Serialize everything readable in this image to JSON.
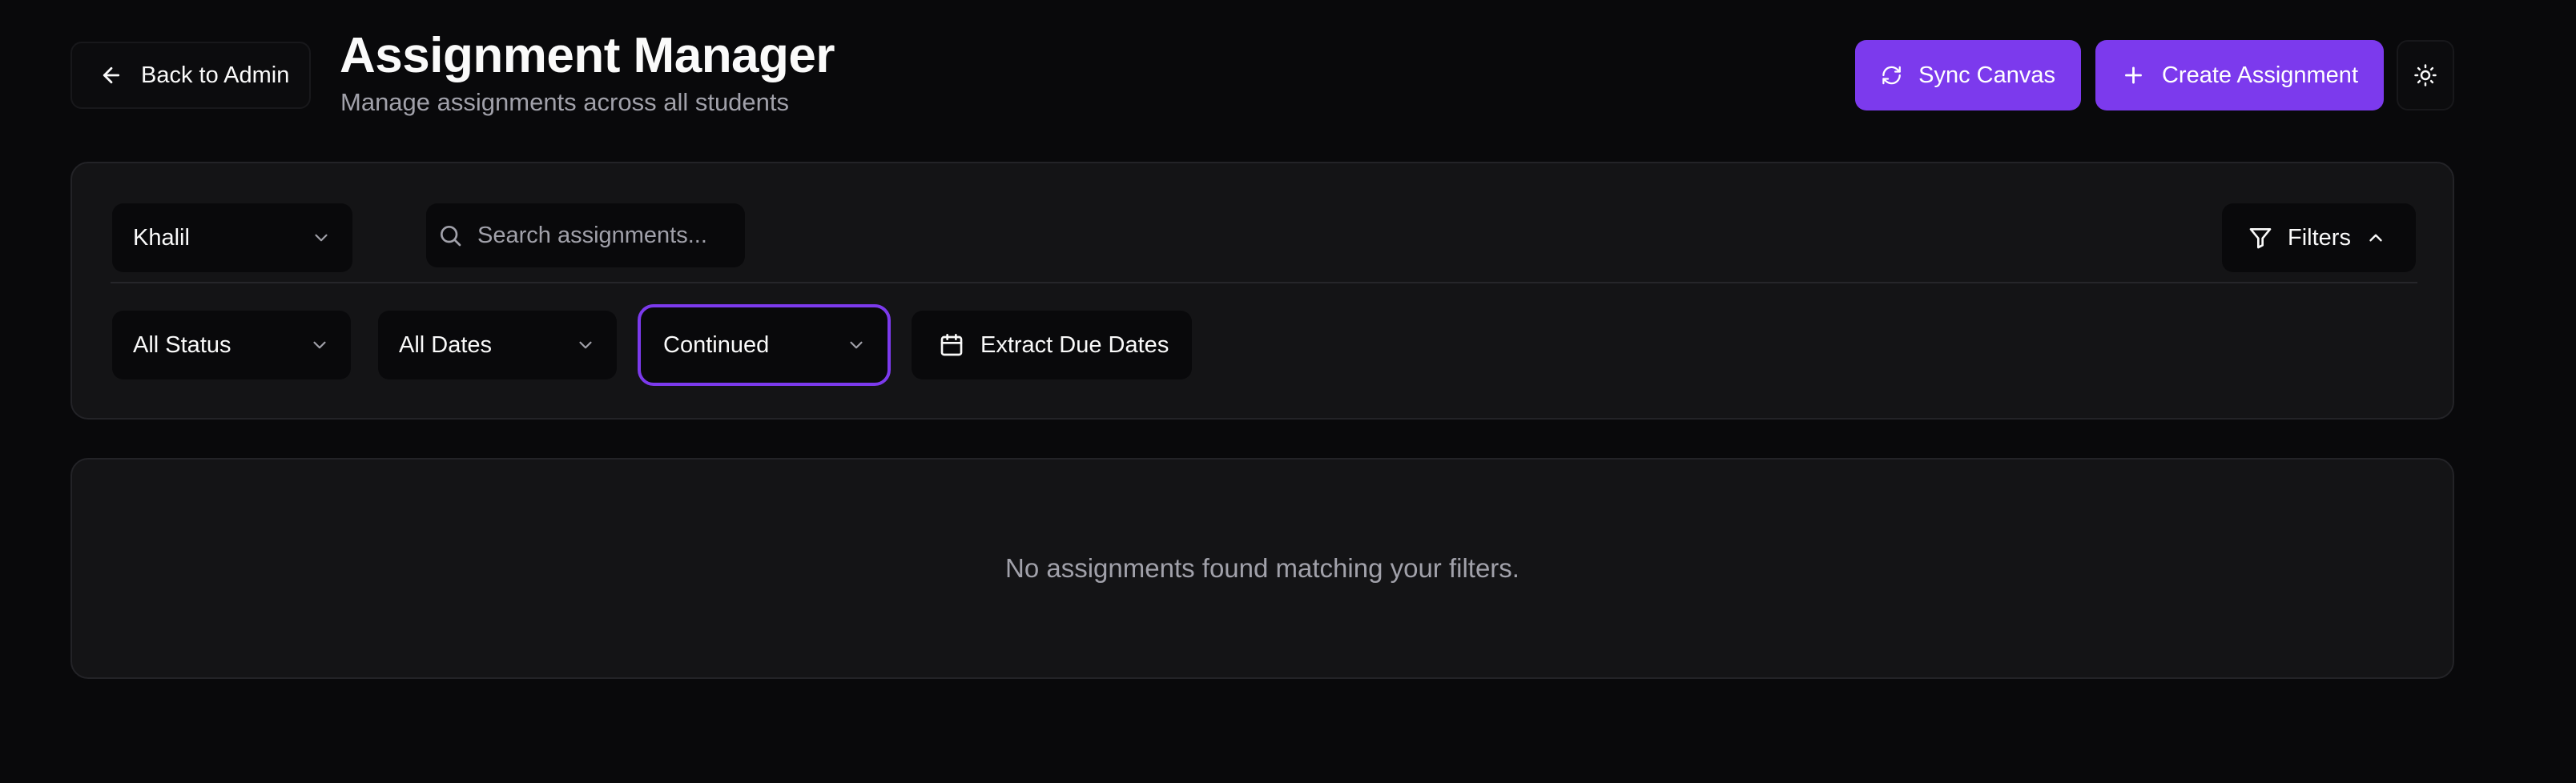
{
  "header": {
    "back_label": "Back to Admin",
    "title": "Assignment Manager",
    "subtitle": "Manage assignments across all students",
    "sync_label": "Sync Canvas",
    "create_label": "Create Assignment"
  },
  "filters": {
    "student": "Khalil",
    "search_placeholder": "Search assignments...",
    "search_value": "",
    "filters_label": "Filters",
    "status": "All Status",
    "dates": "All Dates",
    "type": "Continued",
    "extract_label": "Extract Due Dates"
  },
  "results": {
    "empty_message": "No assignments found matching your filters."
  },
  "colors": {
    "accent": "#7c3aed",
    "background": "#09090b",
    "card": "#141416",
    "muted_text": "#a1a1aa"
  },
  "icons": {
    "back": "arrow-left-icon",
    "sync": "refresh-icon",
    "create": "plus-icon",
    "theme": "sun-icon",
    "search": "search-icon",
    "filter": "funnel-icon",
    "calendar": "calendar-icon"
  }
}
